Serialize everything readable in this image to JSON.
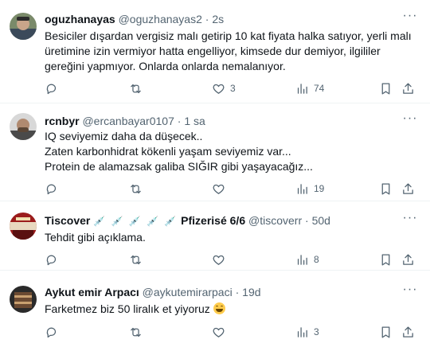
{
  "tweets": [
    {
      "name": "oguzhanayas",
      "handle": "@oguzhanayas2",
      "separator": "·",
      "time": "2s",
      "more_label": "···",
      "text": "Besiciler dışardan vergisiz malı getirip 10 kat fiyata halka satıyor, yerli malı üretimine izin vermiyor hatta engelliyor, kimsede dur demiyor, ilgililer gereğini yapmıyor. Onlarda onlarda nemalanıyor.",
      "replies": "",
      "retweets": "",
      "likes": "3",
      "views": "74"
    },
    {
      "name": "rcnbyr",
      "handle": "@ercanbayar0107",
      "separator": "·",
      "time": "1 sa",
      "more_label": "···",
      "text": "IQ seviyemiz daha da düşecek..\nZaten karbonhidrat kökenli yaşam seviyemiz var...\nProtein de alamazsak galiba SIĞIR gibi yaşayacağız...",
      "replies": "",
      "retweets": "",
      "likes": "",
      "views": "19"
    },
    {
      "name": "Tiscover",
      "name_suffix": "Pfizerisé 6/6",
      "name_emoji": "💉 💉 💉 💉 💉",
      "handle": "@tiscoverr",
      "separator": "·",
      "time": "50d",
      "more_label": "···",
      "text": "Tehdit gibi açıklama.",
      "replies": "",
      "retweets": "",
      "likes": "",
      "views": "8"
    },
    {
      "name": "Aykut emir Arpacı",
      "handle": "@aykutemirarpaci",
      "separator": "·",
      "time": "19d",
      "more_label": "···",
      "text": "Farketmez biz 50 liralık et yiyoruz",
      "replies": "",
      "retweets": "",
      "likes": "",
      "views": "3"
    }
  ],
  "colors": {
    "text": "#0f1419",
    "secondary": "#536471",
    "divider": "#eff3f4"
  },
  "icons": [
    "reply-icon",
    "retweet-icon",
    "like-icon",
    "views-icon",
    "bookmark-icon",
    "share-icon",
    "more-icon",
    "grinning-face-emoji"
  ]
}
